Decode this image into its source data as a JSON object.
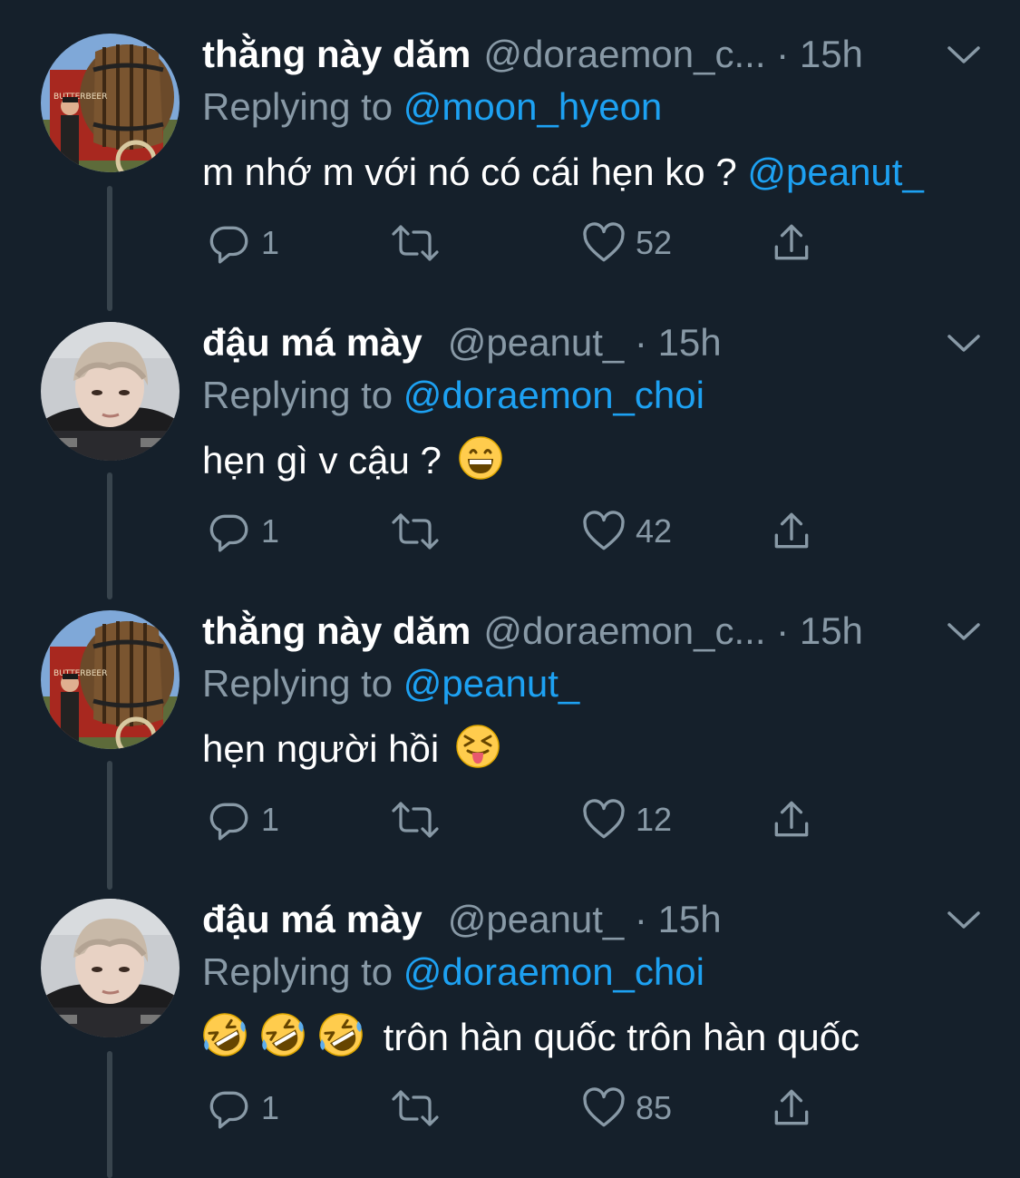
{
  "theme": {
    "background": "#15202b",
    "text": "#ffffff",
    "secondary": "#8899a6",
    "accent": "#1da1f2",
    "thread_line": "#38444d"
  },
  "tweets": [
    {
      "display_name": "thằng này dăm",
      "handle": "@doraemon_c...",
      "time": "15h",
      "replying_label": "Replying to",
      "replying_to": "@moon_hyeon",
      "text": "m nhớ m với nó có cái hẹn ko ?",
      "text_mention": "@peanut_",
      "emojis": [],
      "avatar": "barrel-photo",
      "replies": "1",
      "likes": "52"
    },
    {
      "display_name": "đậu má mày",
      "handle": "@peanut_",
      "time": "15h",
      "replying_label": "Replying to",
      "replying_to": "@doraemon_choi",
      "text": "hẹn gì v cậu ?",
      "text_mention": "",
      "emojis": [
        "grinning-face"
      ],
      "avatar": "portrait-photo",
      "replies": "1",
      "likes": "42"
    },
    {
      "display_name": "thằng này dăm",
      "handle": "@doraemon_c...",
      "time": "15h",
      "replying_label": "Replying to",
      "replying_to": "@peanut_",
      "text": "hẹn người hồi",
      "text_mention": "",
      "emojis": [
        "squinting-tongue-face"
      ],
      "avatar": "barrel-photo",
      "replies": "1",
      "likes": "12"
    },
    {
      "display_name": "đậu má mày",
      "handle": "@peanut_",
      "time": "15h",
      "replying_label": "Replying to",
      "replying_to": "@doraemon_choi",
      "text": "trôn hàn quốc trôn hàn quốc",
      "text_mention": "",
      "emojis": [
        "rolling-laughing-face",
        "rolling-laughing-face",
        "rolling-laughing-face"
      ],
      "avatar": "portrait-photo",
      "replies": "1",
      "likes": "85"
    }
  ],
  "icons": {
    "reply": "reply-icon",
    "retweet": "retweet-icon",
    "like": "heart-icon",
    "share": "share-icon",
    "more": "chevron-down-icon"
  }
}
